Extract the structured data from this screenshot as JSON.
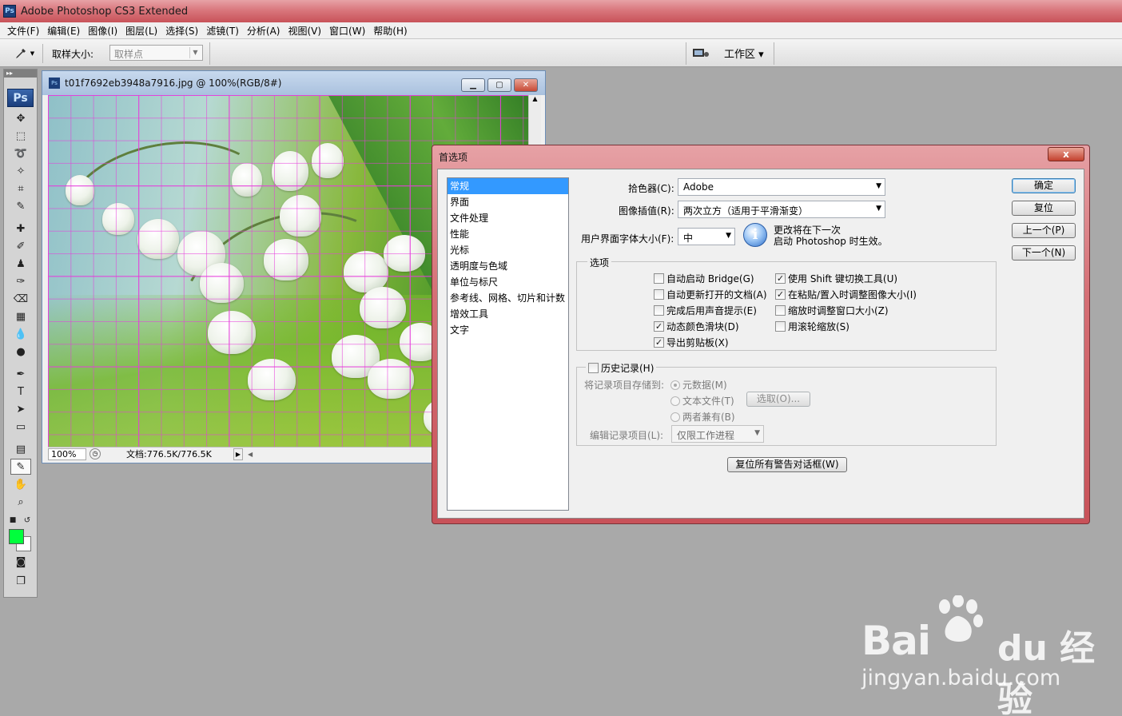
{
  "app": {
    "title": "Adobe Photoshop CS3 Extended",
    "logo": "Ps"
  },
  "menu": [
    "文件(F)",
    "编辑(E)",
    "图像(I)",
    "图层(L)",
    "选择(S)",
    "滤镜(T)",
    "分析(A)",
    "视图(V)",
    "窗口(W)",
    "帮助(H)"
  ],
  "options": {
    "sample_size_label": "取样大小:",
    "sample_size_value": "取样点",
    "workspace": "工作区 ▾"
  },
  "toolbox": {
    "logo": "Ps"
  },
  "document": {
    "title": "t01f7692eb3948a7916.jpg @ 100%(RGB/8#)",
    "zoom": "100%",
    "doc_info": "文档:776.5K/776.5K"
  },
  "prefs": {
    "title": "首选项",
    "close": "x",
    "categories": [
      "常规",
      "界面",
      "文件处理",
      "性能",
      "光标",
      "透明度与色域",
      "单位与标尺",
      "参考线、网格、切片和计数",
      "增效工具",
      "文字"
    ],
    "selected_category": "常规",
    "color_picker_label": "拾色器(C):",
    "color_picker_value": "Adobe",
    "interp_label": "图像插值(R):",
    "interp_value": "两次立方（适用于平滑渐变）",
    "ui_font_label": "用户界面字体大小(F):",
    "ui_font_value": "中",
    "notice_line1": "更改将在下一次",
    "notice_line2": "启动 Photoshop 时生效。",
    "options_group": "选项",
    "checkboxes": [
      {
        "label": "自动启动 Bridge(G)",
        "checked": false
      },
      {
        "label": "自动更新打开的文档(A)",
        "checked": false
      },
      {
        "label": "完成后用声音提示(E)",
        "checked": false
      },
      {
        "label": "动态颜色滑块(D)",
        "checked": true
      },
      {
        "label": "导出剪贴板(X)",
        "checked": true
      },
      {
        "label": "使用 Shift 键切换工具(U)",
        "checked": true
      },
      {
        "label": "在粘贴/置入时调整图像大小(I)",
        "checked": true
      },
      {
        "label": "缩放时调整窗口大小(Z)",
        "checked": false
      },
      {
        "label": "用滚轮缩放(S)",
        "checked": false
      }
    ],
    "history_label": "历史记录(H)",
    "history_save_label": "将记录项目存储到:",
    "radios": [
      {
        "label": "元数据(M)",
        "selected": true
      },
      {
        "label": "文本文件(T)",
        "selected": false
      },
      {
        "label": "两者兼有(B)",
        "selected": false
      }
    ],
    "choose_button": "选取(O)...",
    "edit_log_label": "编辑记录项目(L):",
    "edit_log_value": "仅限工作进程",
    "reset_warnings": "复位所有警告对话框(W)",
    "ok": "确定",
    "reset": "复位",
    "prev": "上一个(P)",
    "next": "下一个(N)"
  },
  "watermark": {
    "brand": "Bai",
    "brand2": "du 经验",
    "url": "jingyan.baidu.com"
  }
}
